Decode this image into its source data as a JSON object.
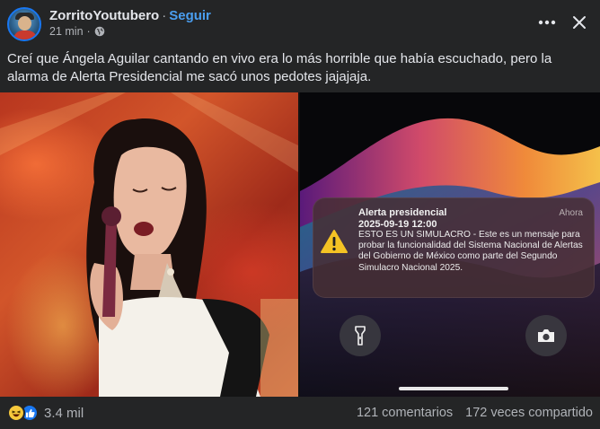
{
  "post": {
    "author": "ZorritoYoutubero",
    "separator": "·",
    "follow_label": "Seguir",
    "time_ago": "21 min",
    "time_separator": "·",
    "privacy_icon": "globe-icon",
    "more_icon": "more-horizontal-icon",
    "close_icon": "close-icon",
    "text": "Creí que Ángela Aguilar cantando en vivo era lo más horrible que había escuchado, pero la alarma de Alerta Presidencial me sacó unos pedotes jajajaja."
  },
  "alert": {
    "title": "Alerta presidencial",
    "time": "Ahora",
    "date": "2025-09-19 12:00",
    "body": "ESTO ES UN SIMULACRO - Este es un mensaje para probar la funcionalidad del Sistema Nacional de Alertas del Gobierno de México como parte del Segundo Simulacro Nacional 2025.",
    "icon": "warning-icon",
    "flashlight_icon": "flashlight-icon",
    "camera_icon": "camera-icon"
  },
  "footer": {
    "reactions_count": "3.4 mil",
    "comments": "121 comentarios",
    "shares": "172 veces compartido"
  },
  "colors": {
    "background": "#242526",
    "text": "#e4e6eb",
    "secondary_text": "#b0b3b8",
    "link": "#4a9ef0",
    "warning": "#f4c324"
  }
}
